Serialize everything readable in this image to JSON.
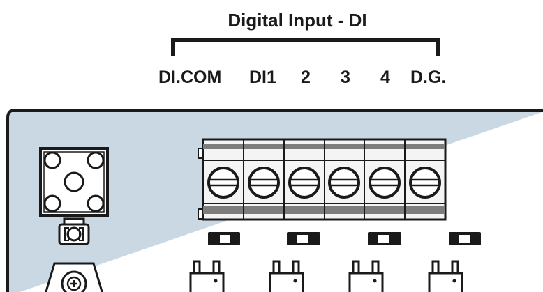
{
  "title": "Digital Input  - DI",
  "terminal_labels": [
    "DI.COM",
    "DI1",
    "2",
    "3",
    "4",
    "D.G."
  ],
  "colors": {
    "panel_fill": "#c9d8e2",
    "outline": "#1a1a1a",
    "terminal_body": "#f4f4f4",
    "terminal_band": "#7d7d7d",
    "white": "#ffffff"
  },
  "components": {
    "left_connector": "square-four-hole-connector",
    "left_knob": "rotary-knob",
    "left_jack": "round-jack",
    "terminal_block": "six-screw-terminal-block",
    "switches": "four-slide-switches",
    "relays": "four-relay-components"
  }
}
